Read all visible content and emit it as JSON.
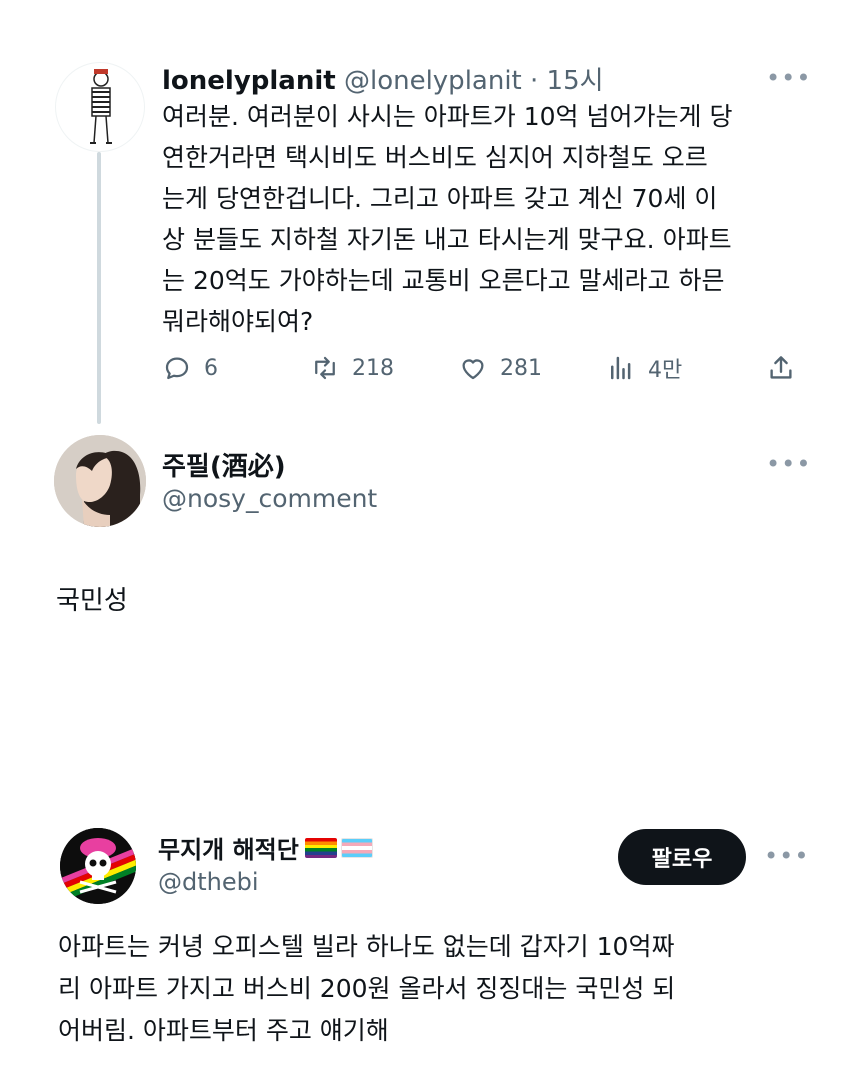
{
  "tweet1": {
    "name": "lonelyplanit",
    "handle": "@lonelyplanit",
    "separator": " · ",
    "time": "15시",
    "text_lines": [
      "여러분. 여러분이 사시는 아파트가 10억 넘어가는게 당",
      "연한거라면 택시비도 버스비도 심지어 지하철도 오르",
      "는게 당연한겁니다. 그리고 아파트 갖고 계신 70세 이",
      "상 분들도 지하철 자기돈 내고 타시는게 맞구요. 아파트",
      "는 20억도 가야하는데 교통비 오른다고 말세라고 하믄",
      "뭐라해야되여?"
    ],
    "replies": "6",
    "retweets": "218",
    "likes": "281",
    "views": "4만",
    "more_icon": "more-horizontal-icon"
  },
  "tweet2": {
    "name": "주필(酒必)",
    "handle": "@nosy_comment",
    "text": "국민성"
  },
  "tweet3": {
    "name": "무지개 해적단",
    "handle": "@dthebi",
    "follow_label": "팔로우",
    "text_lines": [
      "아파트는 커녕 오피스텔 빌라 하나도 없는데 갑자기 10억짜",
      "리 아파트 가지고 버스비 200원 올라서 징징대는 국민성 되",
      "어버림. 아파트부터 주고 얘기해"
    ]
  },
  "colors": {
    "text": "#0f1419",
    "secondary": "#536471",
    "thread_line": "#cfd9de",
    "button_bg": "#0f1419"
  }
}
